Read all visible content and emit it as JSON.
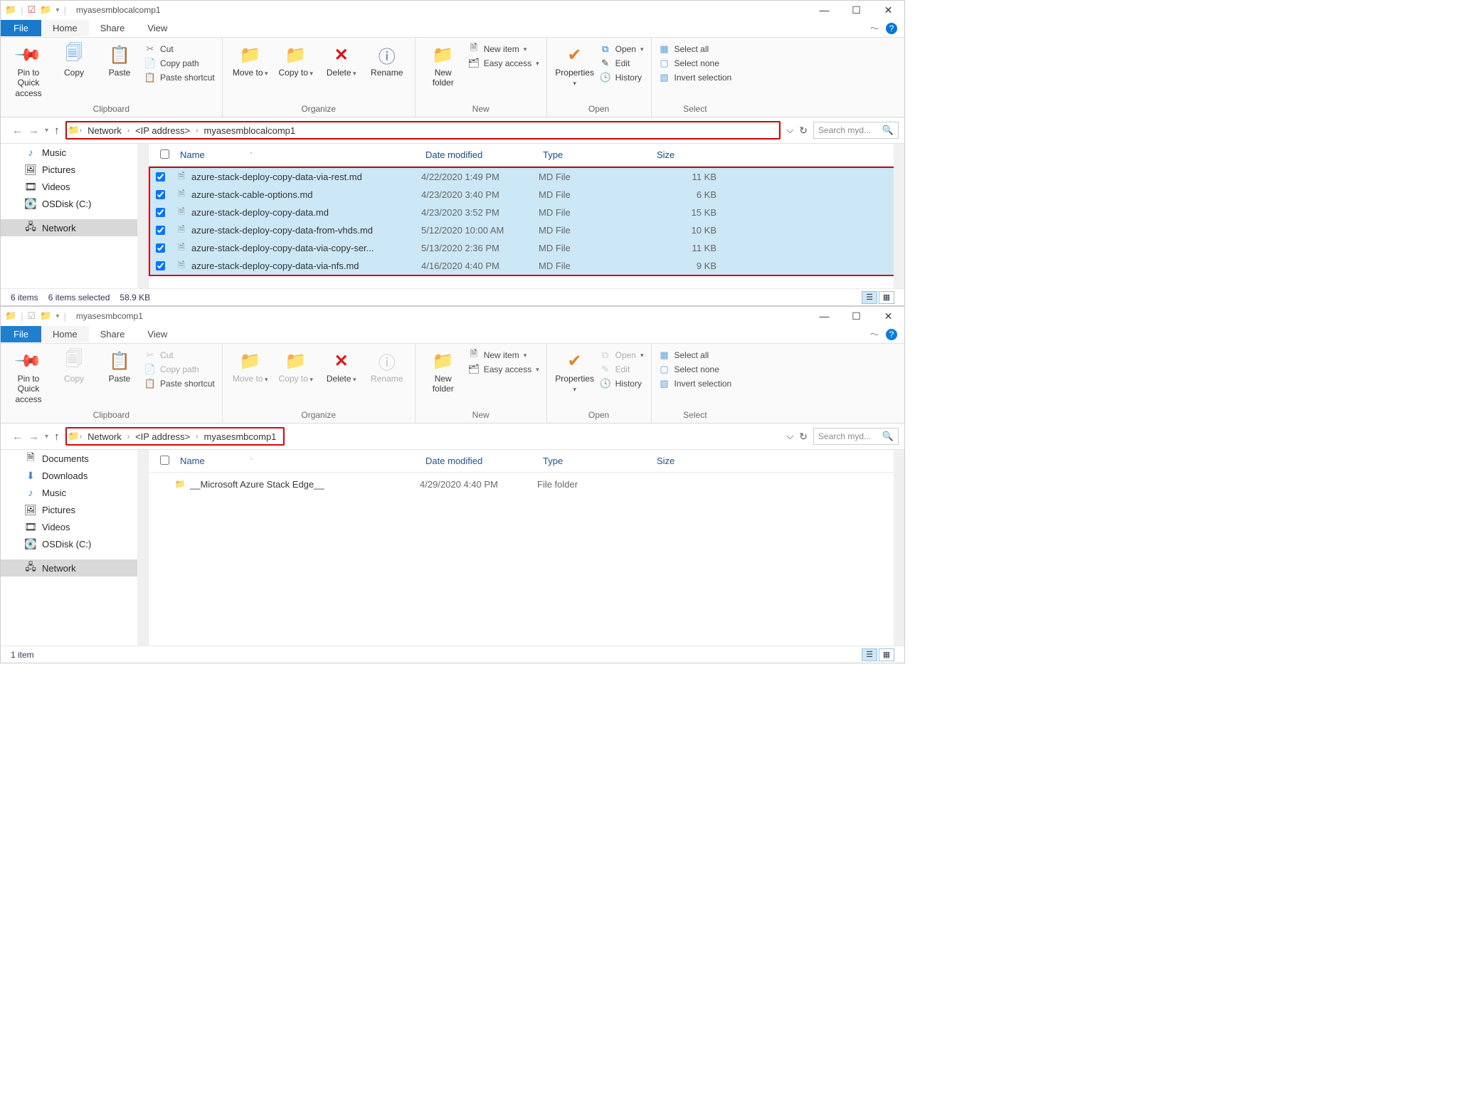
{
  "windows": {
    "top": {
      "title": "myasesmblocalcomp1",
      "breadcrumb": {
        "root": "Network",
        "mid": "<IP address>",
        "leaf": "myasesmblocalcomp1"
      },
      "search_placeholder": "Search myd...",
      "nav": [
        "Music",
        "Pictures",
        "Videos",
        "OSDisk (C:)",
        "Network"
      ],
      "nav_selected": "Network",
      "columns": {
        "name": "Name",
        "date": "Date modified",
        "type": "Type",
        "size": "Size"
      },
      "files": [
        {
          "name": "azure-stack-deploy-copy-data-via-rest.md",
          "date": "4/22/2020 1:49 PM",
          "type": "MD File",
          "size": "11 KB"
        },
        {
          "name": "azure-stack-cable-options.md",
          "date": "4/23/2020 3:40 PM",
          "type": "MD File",
          "size": "6 KB"
        },
        {
          "name": "azure-stack-deploy-copy-data.md",
          "date": "4/23/2020 3:52 PM",
          "type": "MD File",
          "size": "15 KB"
        },
        {
          "name": "azure-stack-deploy-copy-data-from-vhds.md",
          "date": "5/12/2020 10:00 AM",
          "type": "MD File",
          "size": "10 KB"
        },
        {
          "name": "azure-stack-deploy-copy-data-via-copy-ser...",
          "date": "5/13/2020 2:36 PM",
          "type": "MD File",
          "size": "11 KB"
        },
        {
          "name": "azure-stack-deploy-copy-data-via-nfs.md",
          "date": "4/16/2020 4:40 PM",
          "type": "MD File",
          "size": "9 KB"
        }
      ],
      "status": {
        "count": "6 items",
        "sel": "6 items selected",
        "size": "58.9 KB"
      }
    },
    "bottom": {
      "title": "myasesmbcomp1",
      "breadcrumb": {
        "root": "Network",
        "mid": "<IP address>",
        "leaf": "myasesmbcomp1"
      },
      "search_placeholder": "Search myd...",
      "nav": [
        "Documents",
        "Downloads",
        "Music",
        "Pictures",
        "Videos",
        "OSDisk (C:)",
        "Network"
      ],
      "nav_selected": "Network",
      "columns": {
        "name": "Name",
        "date": "Date modified",
        "type": "Type",
        "size": "Size"
      },
      "files": [
        {
          "name": "__Microsoft Azure Stack Edge__",
          "date": "4/29/2020 4:40 PM",
          "type": "File folder",
          "size": ""
        }
      ],
      "status": {
        "count": "1 item"
      }
    }
  },
  "ribbon_tabs": {
    "file": "File",
    "home": "Home",
    "share": "Share",
    "view": "View"
  },
  "ribbon": {
    "clipboard": {
      "label": "Clipboard",
      "pin": "Pin to Quick access",
      "copy": "Copy",
      "paste": "Paste",
      "cut": "Cut",
      "copypath": "Copy path",
      "pastesc": "Paste shortcut"
    },
    "organize": {
      "label": "Organize",
      "moveto": "Move to",
      "copyto": "Copy to",
      "delete": "Delete",
      "rename": "Rename"
    },
    "new": {
      "label": "New",
      "newfolder": "New folder",
      "newitem": "New item",
      "easy": "Easy access"
    },
    "open": {
      "label": "Open",
      "properties": "Properties",
      "open": "Open",
      "edit": "Edit",
      "history": "History"
    },
    "select": {
      "label": "Select",
      "all": "Select all",
      "none": "Select none",
      "invert": "Invert selection"
    }
  }
}
